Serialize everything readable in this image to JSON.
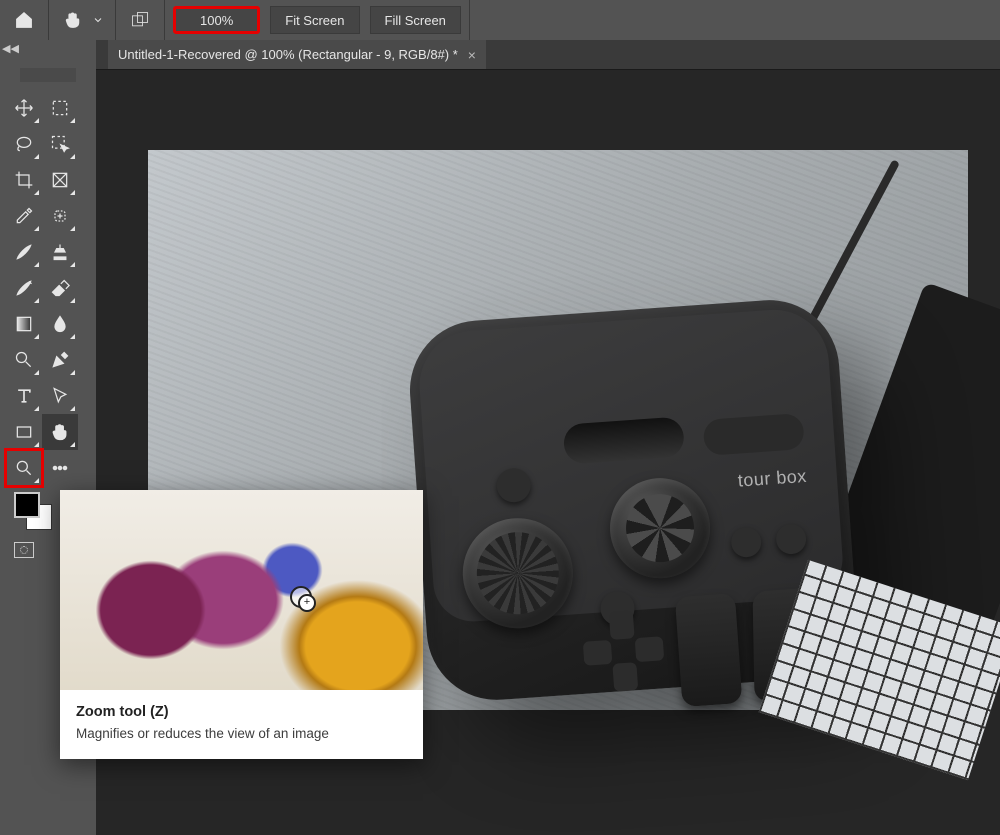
{
  "topbar": {
    "zoom_value": "100%",
    "fit_screen": "Fit Screen",
    "fill_screen": "Fill Screen"
  },
  "document": {
    "tab_title": "Untitled-1-Recovered @ 100% (Rectangular - 9, RGB/8#) *"
  },
  "tooltip": {
    "title": "Zoom tool (Z)",
    "desc": "Magnifies or reduces the view of an image"
  },
  "tools": {
    "left_col": [
      "move",
      "lasso",
      "crop",
      "eyedropper",
      "brush",
      "history-brush",
      "gradient",
      "dodge",
      "type",
      "rectangle",
      "zoom"
    ],
    "right_col": [
      "marquee",
      "object-select",
      "frame",
      "spot-heal",
      "clone",
      "eraser",
      "blur",
      "pen",
      "path-select",
      "hand",
      "more"
    ]
  },
  "controller_brand": "tour\nbox"
}
